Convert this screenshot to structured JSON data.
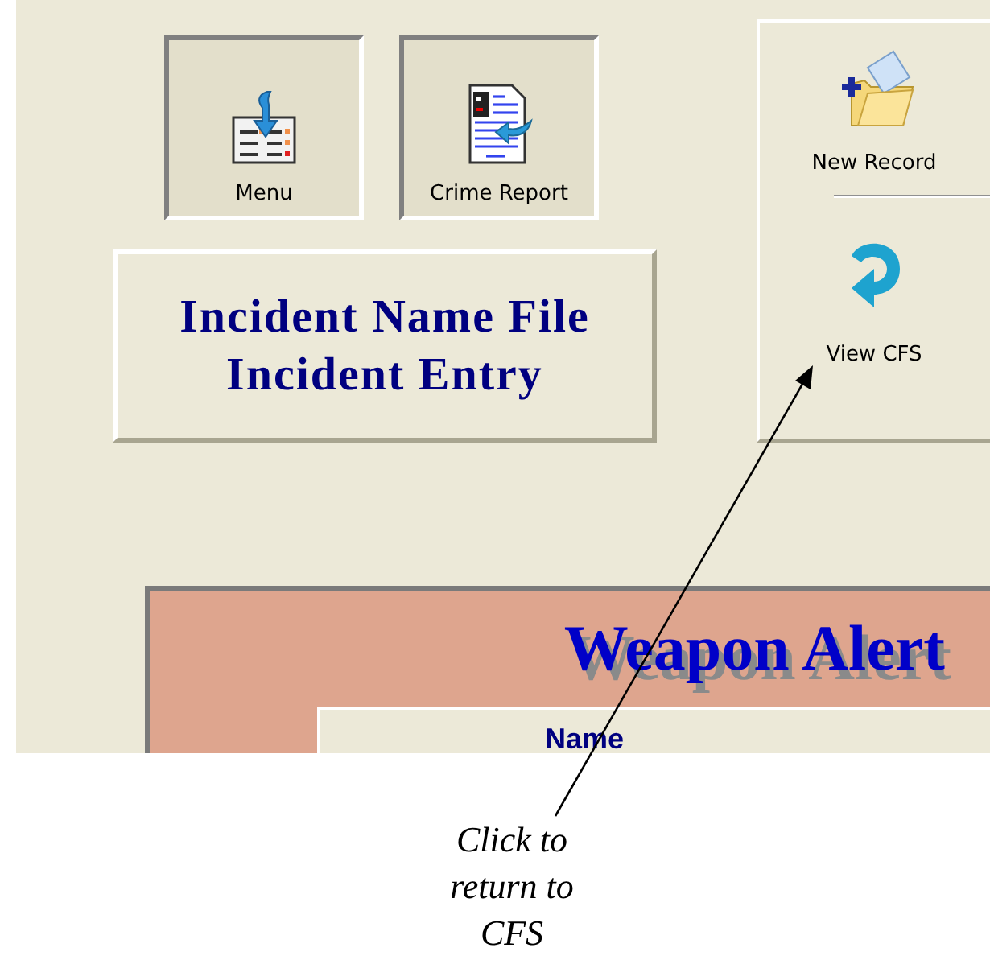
{
  "toolbar_buttons": [
    {
      "label": "Menu"
    },
    {
      "label": "Crime Report"
    }
  ],
  "title_panel": {
    "lines": [
      "Incident Name File",
      "Incident Entry"
    ]
  },
  "side_panel": {
    "buttons": [
      {
        "label": "New Record"
      },
      {
        "label": "View CFS"
      }
    ]
  },
  "weapon_alert": {
    "title": "Weapon Alert",
    "columns": [
      "Name"
    ]
  },
  "annotation": {
    "text": "Click to return to CFS"
  }
}
